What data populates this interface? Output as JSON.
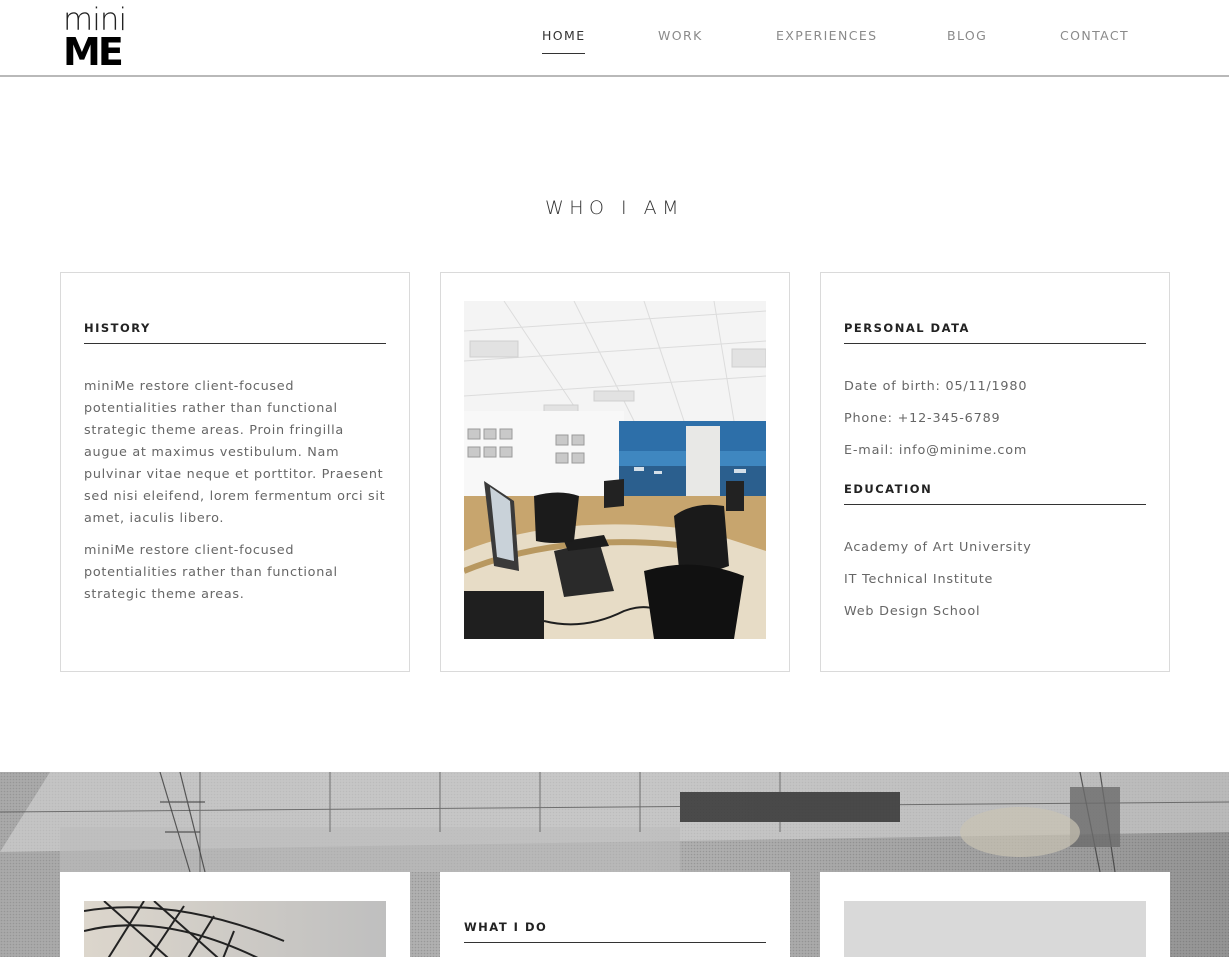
{
  "logo": {
    "top": "mini",
    "bottom": "ME"
  },
  "nav": {
    "items": [
      {
        "label": "HOME",
        "active": true
      },
      {
        "label": "WORK",
        "active": false
      },
      {
        "label": "EXPERIENCES",
        "active": false
      },
      {
        "label": "BLOG",
        "active": false
      },
      {
        "label": "CONTACT",
        "active": false
      }
    ]
  },
  "section": {
    "title": "WHO I AM"
  },
  "history": {
    "heading": "HISTORY",
    "paragraphs": [
      "miniMe restore client-focused potentialities rather than functional strategic theme areas. Proin fringilla augue at maximus vestibulum. Nam pulvinar vitae neque et porttitor. Praesent sed nisi eleifend, lorem fermentum orci sit amet, iaculis libero.",
      "miniMe restore client-focused potentialities rather than functional strategic theme areas."
    ]
  },
  "personal": {
    "heading": "PERSONAL DATA",
    "dob": "Date of birth: 05/11/1980",
    "phone": "Phone: +12-345-6789",
    "email": "E-mail: info@minime.com"
  },
  "education": {
    "heading": "EDUCATION",
    "items": [
      "Academy of Art University",
      "IT Technical Institute",
      "Web Design School"
    ]
  },
  "what_i_do": {
    "heading": "WHAT I DO"
  },
  "colors": {
    "accent": "#333333",
    "text": "#666666",
    "nav_inactive": "#8a8a8a",
    "border": "#dadada"
  }
}
